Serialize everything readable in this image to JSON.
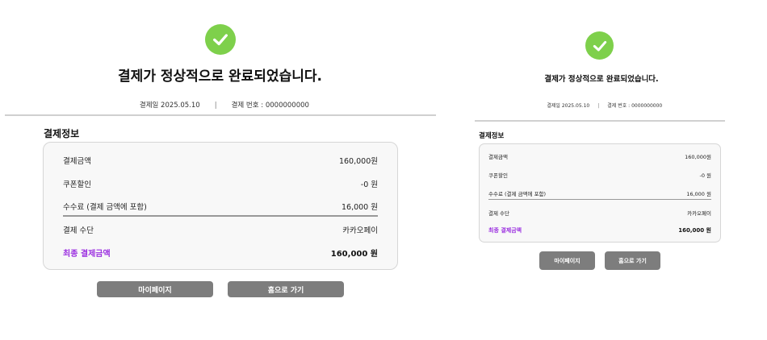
{
  "completion": {
    "title": "결제가 정상적으로 완료되었습니다.",
    "date_text": "결제일 2025.05.10",
    "separator": "|",
    "order_text": "결제 번호 : 0000000000"
  },
  "payment_info": {
    "section_title": "결제정보",
    "rows": [
      {
        "label": "결제금액",
        "value": "160,000원"
      },
      {
        "label": "쿠폰할인",
        "value": "-0 원"
      },
      {
        "label": "수수료 (결제 금액에 포함)",
        "value": "16,000 원"
      },
      {
        "label": "결제 수단",
        "value": "카카오페이"
      },
      {
        "label": "최종 결제금액",
        "value": "160,000 원"
      }
    ]
  },
  "buttons": {
    "mypage": "마이페이지",
    "home": "홈으로 가기"
  },
  "colors": {
    "check": "#7ed04b",
    "highlight": "#9b30e0",
    "button": "#7d7d7d"
  }
}
